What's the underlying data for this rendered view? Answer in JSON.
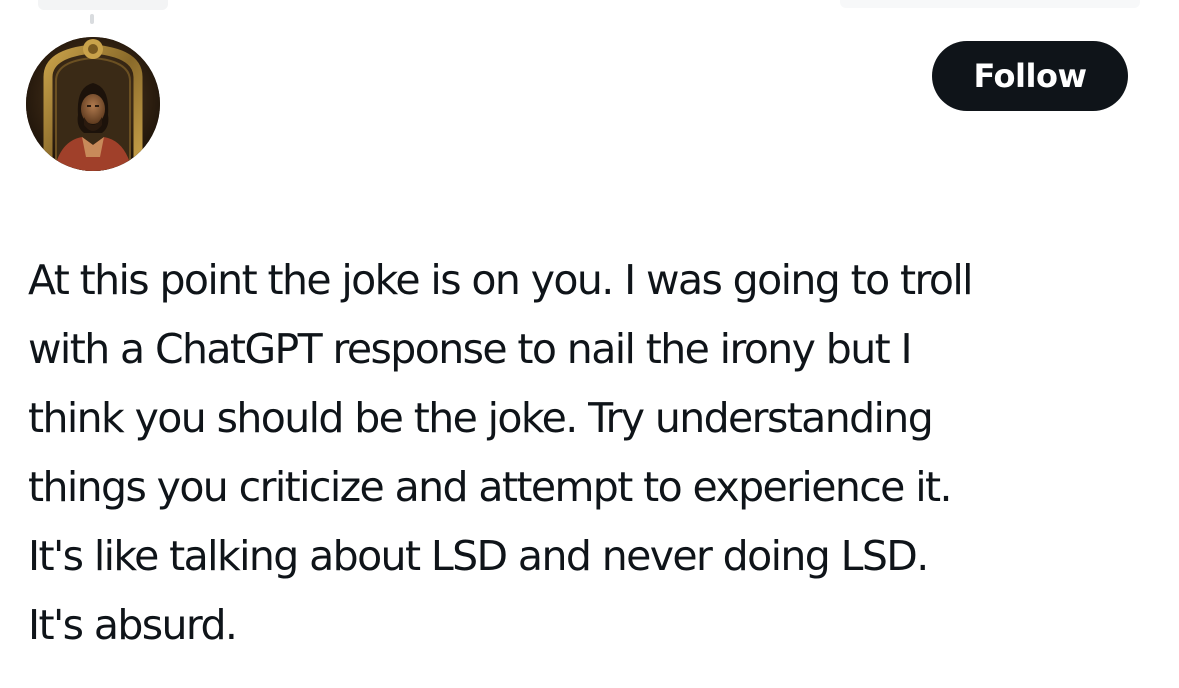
{
  "header": {
    "follow_label": "Follow",
    "avatar_icon": "avatar-portrait-icon"
  },
  "tweet": {
    "lines": [
      "At this point the joke is on you. I was going to troll",
      "with a ChatGPT response to nail the irony but I",
      "think you should be the joke. Try understanding",
      "things you criticize and attempt to experience it.",
      "It's like talking about LSD and never doing LSD.",
      "It's absurd."
    ]
  },
  "colors": {
    "text": "#0f1419",
    "button_bg": "#0f1419",
    "button_text": "#ffffff",
    "background": "#ffffff"
  }
}
